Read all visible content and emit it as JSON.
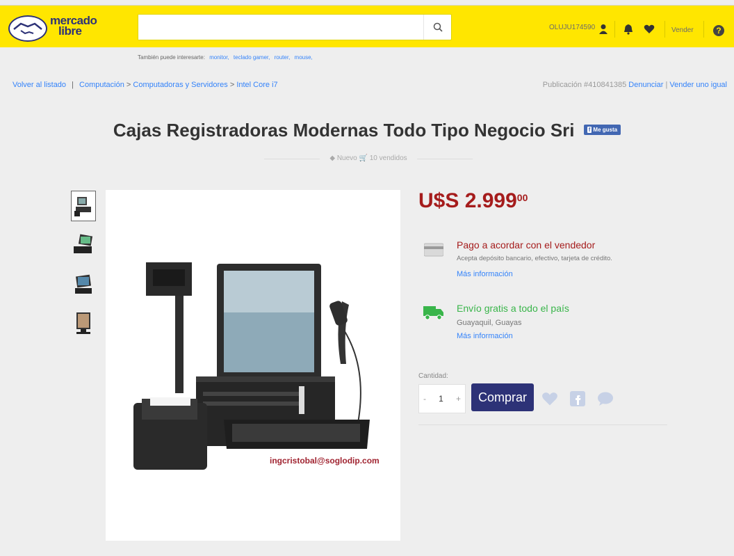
{
  "header": {
    "logo_line1": "mercado",
    "logo_line2": "libre",
    "search_placeholder": "",
    "username": "OLUJU174590",
    "sell_label": "Vender",
    "help_symbol": "?"
  },
  "suggestions": {
    "label": "También puede interesarte:",
    "items": [
      "monitor,",
      "teclado gamer,",
      "router,",
      "mouse,"
    ]
  },
  "breadcrumb": {
    "back": "Volver al listado",
    "separator": "|",
    "path": [
      "Computación",
      "Computadoras y Servidores",
      "Intel Core i7"
    ],
    "arrow": ">"
  },
  "publication": {
    "label": "Publicación #410841385",
    "report": "Denunciar",
    "sell_similar": "Vender uno igual"
  },
  "product": {
    "title": "Cajas Registradoras Modernas Todo Tipo Negocio Sri",
    "like_label": "Me gusta",
    "condition": "Nuevo",
    "sold": "10 vendidos",
    "watermark": "ingcristobal@soglodip.com"
  },
  "price": {
    "main": "U$S 2.999",
    "cents": "00"
  },
  "payment": {
    "title": "Pago a acordar con el vendedor",
    "subtitle": "Acepta depósito bancario, efectivo, tarjeta de crédito.",
    "link": "Más información"
  },
  "shipping": {
    "title": "Envío gratis a todo el país",
    "location": "Guayaquil, Guayas",
    "link": "Más información"
  },
  "purchase": {
    "qty_label": "Cantidad:",
    "qty_value": "1",
    "minus": "-",
    "plus": "+",
    "buy_label": "Comprar"
  },
  "icons": {
    "search": "search-icon",
    "user": "user-icon",
    "bell": "bell-icon",
    "heart": "heart-icon",
    "help": "help-icon",
    "card": "credit-card-icon",
    "truck": "truck-icon",
    "facebook": "facebook-icon",
    "chat": "chat-icon",
    "tag": "tag-icon",
    "cart": "cart-icon"
  },
  "colors": {
    "header_bg": "#ffe600",
    "brand_blue": "#2d3277",
    "price_red": "#a51c1c",
    "shipping_green": "#39b54a",
    "link_blue": "#3483fa"
  }
}
